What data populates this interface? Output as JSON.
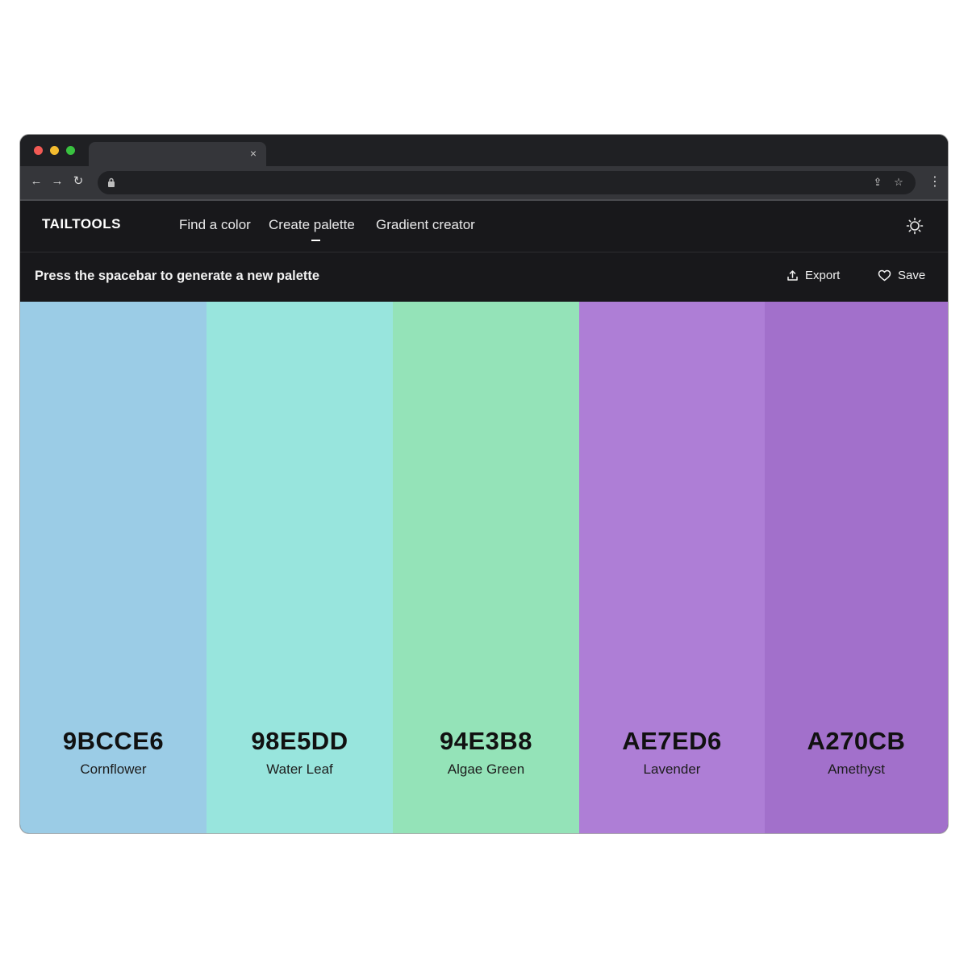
{
  "browser": {
    "tab_close": "×",
    "nav": {
      "back": "←",
      "forward": "→",
      "reload": "↻"
    },
    "omnibox_icons": {
      "share": "⇪",
      "bookmark": "☆"
    },
    "menu": "⋮"
  },
  "app": {
    "logo": "TAILTOOLS",
    "nav": [
      {
        "label": "Find a color",
        "active": false
      },
      {
        "label": "Create palette",
        "active": true
      },
      {
        "label": "Gradient creator",
        "active": false
      }
    ],
    "theme_toggle_icon": "sun-icon"
  },
  "subbar": {
    "hint": "Press the spacebar to generate a new palette",
    "export_label": "Export",
    "save_label": "Save"
  },
  "palette": [
    {
      "hex": "9BCCE6",
      "name": "Cornflower",
      "color": "#9BCCE6"
    },
    {
      "hex": "98E5DD",
      "name": "Water Leaf",
      "color": "#98E5DD"
    },
    {
      "hex": "94E3B8",
      "name": "Algae Green",
      "color": "#94E3B8"
    },
    {
      "hex": "AE7ED6",
      "name": "Lavender",
      "color": "#AE7ED6"
    },
    {
      "hex": "A270CB",
      "name": "Amethyst",
      "color": "#A270CB"
    }
  ]
}
